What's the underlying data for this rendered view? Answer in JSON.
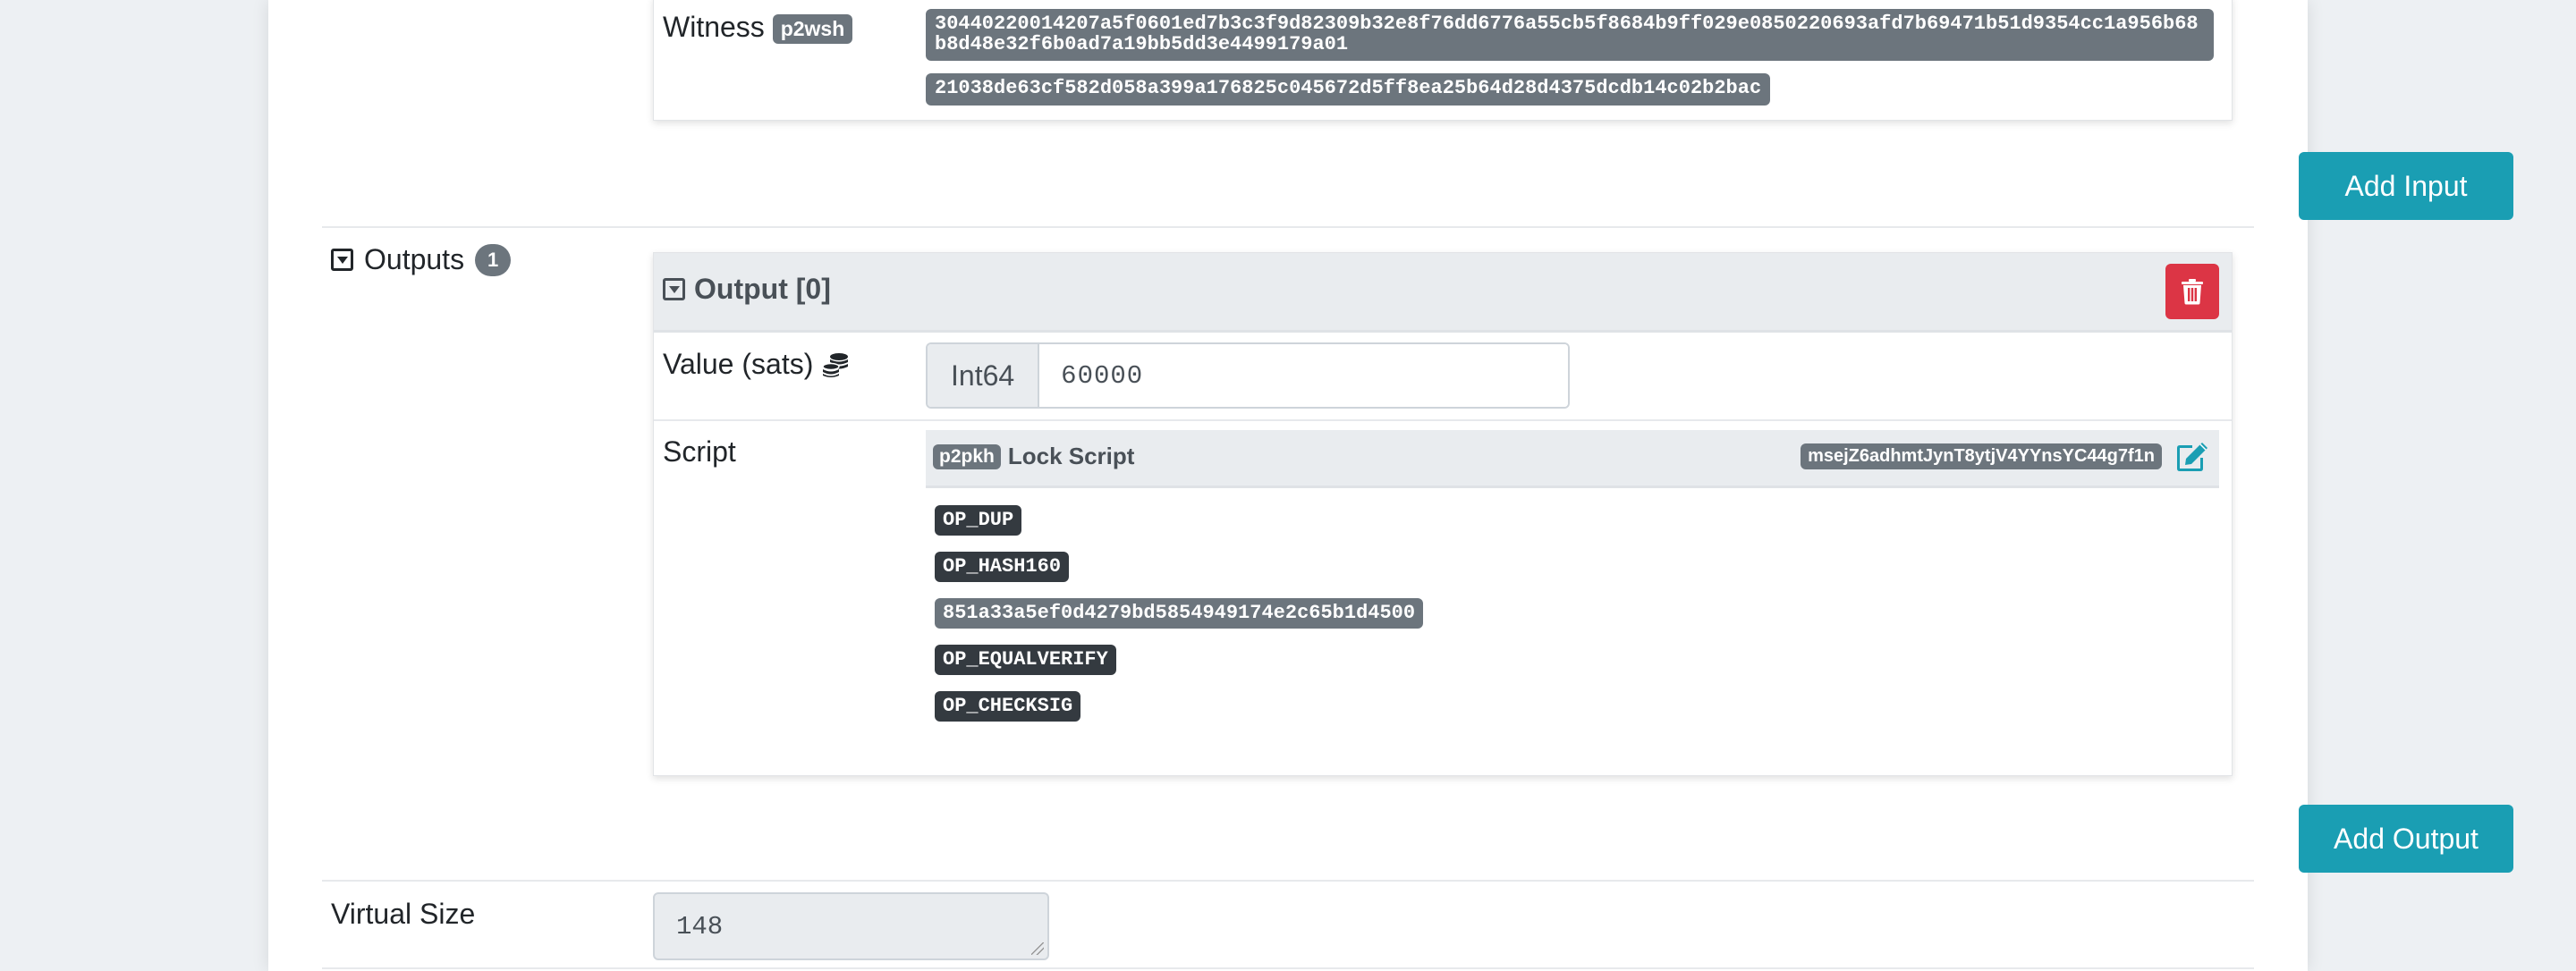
{
  "inputs_section": {
    "witness_label": "Witness",
    "witness_type_badge": "p2wsh",
    "witness_items": [
      "30440220014207a5f0601ed7b3c3f9d82309b32e8f76dd6776a55cb5f8684b9ff029e0850220693afd7b69471b51d9354cc1a956b68b8d48e32f6b0ad7a19bb5dd3e4499179a01",
      "21038de63cf582d058a399a176825c045672d5ff8ea25b64d28d4375dcdb14c02b2bac"
    ],
    "add_input_label": "Add Input"
  },
  "outputs_section": {
    "label": "Outputs",
    "count": "1",
    "output": {
      "title": "Output [0]",
      "value_label": "Value (sats)",
      "value_type": "Int64",
      "value": "60000",
      "script_label": "Script",
      "script_type_badge": "p2pkh",
      "script_title": "Lock Script",
      "address": "msejZ6adhmtJynT8ytjV4YYnsYC44g7f1n",
      "ops": [
        {
          "text": "OP_DUP",
          "kind": "opcode"
        },
        {
          "text": "OP_HASH160",
          "kind": "opcode"
        },
        {
          "text": "851a33a5ef0d4279bd5854949174e2c65b1d4500",
          "kind": "data"
        },
        {
          "text": "OP_EQUALVERIFY",
          "kind": "opcode"
        },
        {
          "text": "OP_CHECKSIG",
          "kind": "opcode"
        }
      ]
    },
    "add_output_label": "Add Output"
  },
  "virtual_size": {
    "label": "Virtual Size",
    "value": "148"
  },
  "colors": {
    "info": "#1a9eb3",
    "danger": "#dc3545",
    "secondary": "#6c757d",
    "dark": "#343a40"
  },
  "icons": {
    "collapse_toggle": "caret-square-down-icon",
    "coins": "coins-icon",
    "delete": "trash-icon",
    "edit": "edit-icon"
  }
}
